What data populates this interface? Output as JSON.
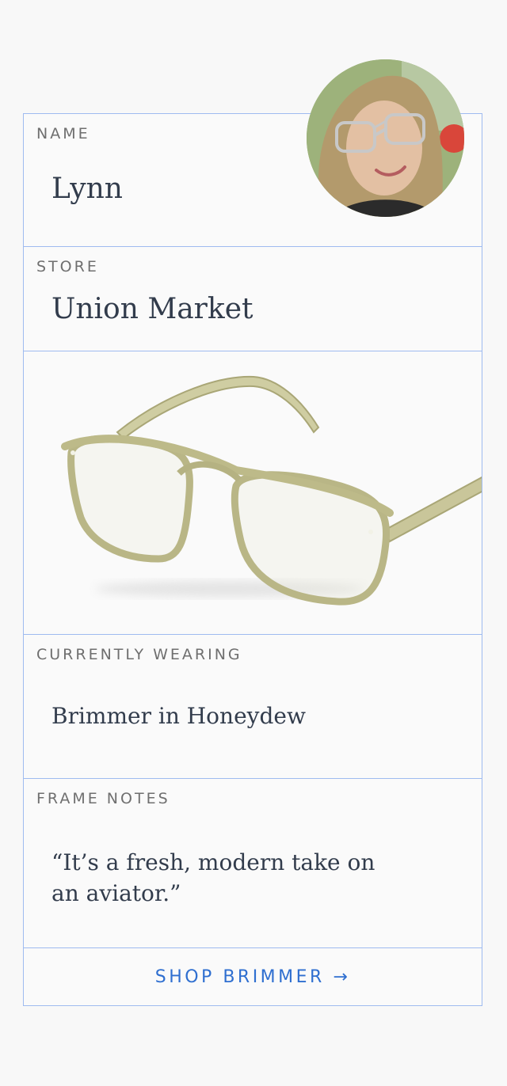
{
  "profile": {
    "name_label": "NAME",
    "name": "Lynn",
    "store_label": "STORE",
    "store": "Union Market"
  },
  "product": {
    "wearing_label": "CURRENTLY WEARING",
    "frame": "Brimmer in Honeydew",
    "notes_label": "FRAME NOTES",
    "notes": "“It’s a fresh, modern take on an aviator.”",
    "frame_color": "#c6c49a"
  },
  "cta": {
    "label": "SHOP BRIMMER →"
  },
  "colors": {
    "border": "#9fbbf0",
    "link": "#2f6fd0",
    "text": "#323c4c",
    "label": "#6f6f6f"
  }
}
